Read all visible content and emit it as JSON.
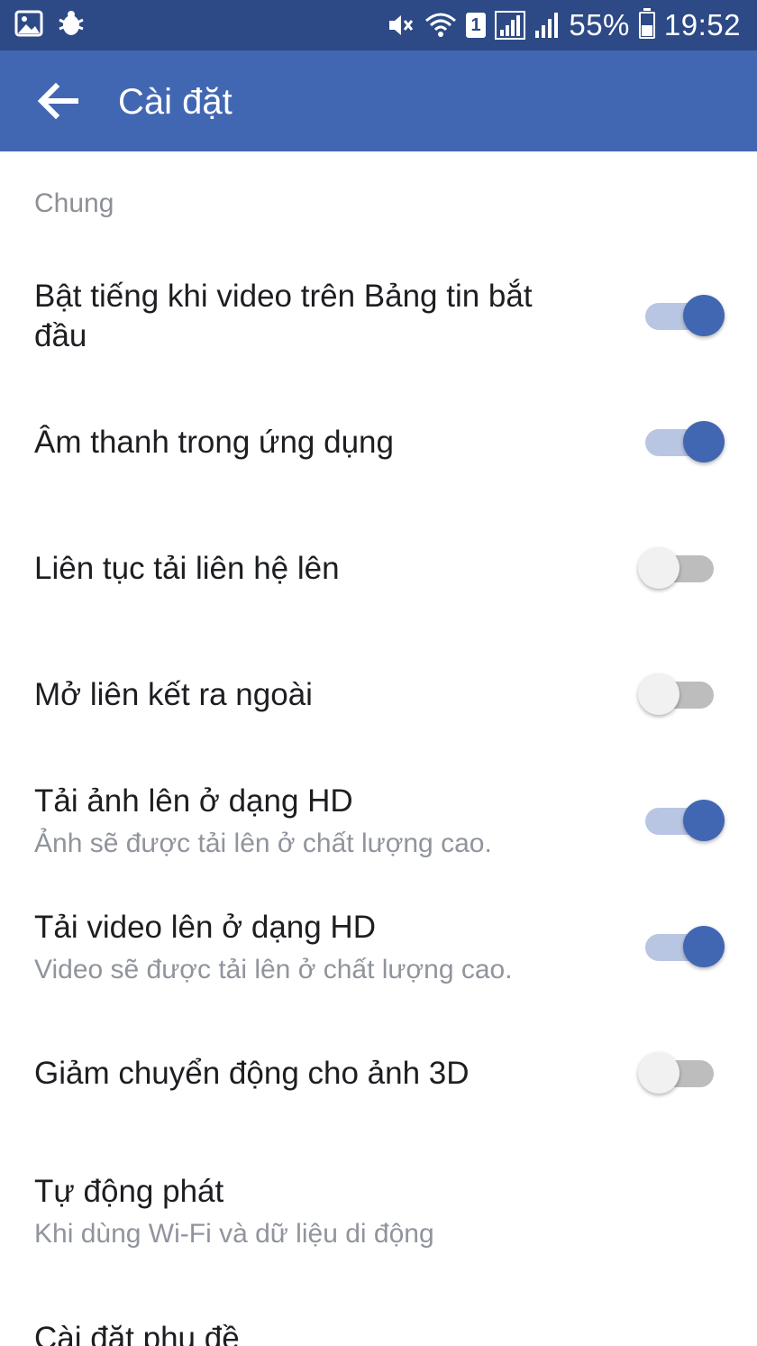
{
  "status_bar": {
    "battery": "55%",
    "time": "19:52",
    "sim_slot": "1",
    "icons": [
      "gallery-icon",
      "bug-icon",
      "mute-icon",
      "wifi-icon",
      "sim-badge",
      "signal-icon",
      "signal-icon",
      "battery-icon"
    ]
  },
  "app_bar": {
    "title": "Cài đặt",
    "back_icon": "back-arrow-icon",
    "background": "#4267b2"
  },
  "section": {
    "header": "Chung"
  },
  "settings": [
    {
      "title": "Bật tiếng khi video trên Bảng tin bắt đầu",
      "subtitle": "",
      "toggle": "on"
    },
    {
      "title": "Âm thanh trong ứng dụng",
      "subtitle": "",
      "toggle": "on"
    },
    {
      "title": "Liên tục tải liên hệ lên",
      "subtitle": "",
      "toggle": "off"
    },
    {
      "title": "Mở liên kết ra ngoài",
      "subtitle": "",
      "toggle": "off"
    },
    {
      "title": "Tải ảnh lên ở dạng HD",
      "subtitle": "Ảnh sẽ được tải lên ở chất lượng cao.",
      "toggle": "on"
    },
    {
      "title": "Tải video lên ở dạng HD",
      "subtitle": "Video sẽ được tải lên ở chất lượng cao.",
      "toggle": "on"
    },
    {
      "title": "Giảm chuyển động cho ảnh 3D",
      "subtitle": "",
      "toggle": "off"
    },
    {
      "title": "Tự động phát",
      "subtitle": "Khi dùng Wi-Fi và dữ liệu di động",
      "toggle": null
    },
    {
      "title": "Cài đặt phụ đề",
      "subtitle": "",
      "toggle": null
    }
  ],
  "colors": {
    "toggle_on_thumb": "#4267b2",
    "toggle_on_track": "#b9c6e3",
    "toggle_off_thumb": "#f1f1f1",
    "toggle_off_track": "#bdbdbd",
    "status_bar": "#2d4a86"
  }
}
